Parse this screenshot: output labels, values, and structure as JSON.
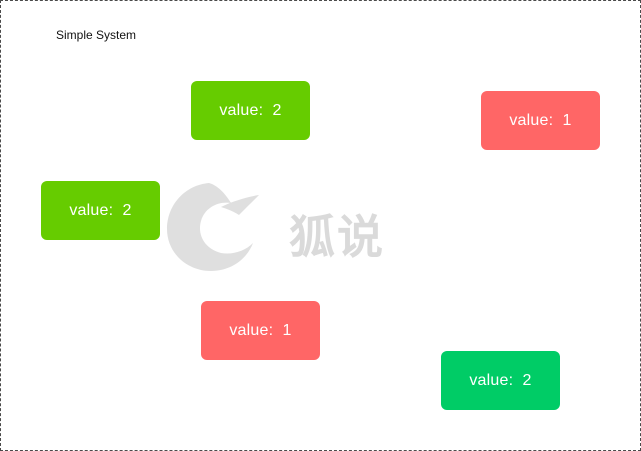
{
  "system": {
    "title": "Simple System"
  },
  "colors": {
    "green": "#66cc00",
    "red": "#ff6666",
    "teal": "#00cc66"
  },
  "nodes": [
    {
      "label": "value:",
      "value": "2",
      "color": "#66cc00"
    },
    {
      "label": "value:",
      "value": "1",
      "color": "#ff6666"
    },
    {
      "label": "value:",
      "value": "2",
      "color": "#66cc00"
    },
    {
      "label": "value:",
      "value": "1",
      "color": "#ff6666"
    },
    {
      "label": "value:",
      "value": "2",
      "color": "#00cc66"
    }
  ],
  "watermark": {
    "text": "狐说",
    "icon": "fox-logo-icon"
  }
}
